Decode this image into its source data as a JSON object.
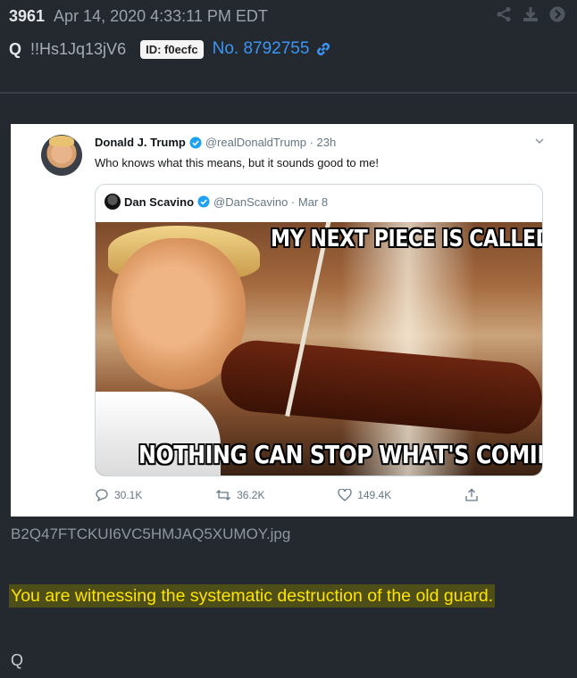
{
  "post": {
    "number": "3961",
    "date": "Apr 14, 2020 4:33:11 PM EDT",
    "poster": "Q",
    "tripcode": "!!Hs1Jq13jV6",
    "id_badge": "ID: f0ecfc",
    "post_no": "No. 8792755",
    "header_icons": [
      "share-icon",
      "download-icon",
      "arrow-right-circle-icon"
    ]
  },
  "tweet": {
    "author_name": "Donald J. Trump",
    "author_handle": "@realDonaldTrump · 23h",
    "text": "Who knows what this means, but it sounds good to me!",
    "quote": {
      "author_name": "Dan Scavino",
      "author_handle": "@DanScavino · Mar 8",
      "meme_top": "MY NEXT PIECE IS CALLED",
      "meme_bottom": "NOTHING CAN STOP WHAT'S COMING"
    },
    "actions": {
      "replies": "30.1K",
      "retweets": "36.2K",
      "likes": "149.4K"
    }
  },
  "attachment": {
    "filename": "B2Q47FTCKUI6VC5HMJAQ5XUMOY.jpg"
  },
  "message": {
    "greentext": "You are witnessing the systematic destruction of the old guard.",
    "signature": "Q"
  },
  "colors": {
    "background": "#24292f",
    "link": "#3b96f5",
    "greentext": "#ffe400",
    "greentext_bg": "#4e4e18"
  }
}
